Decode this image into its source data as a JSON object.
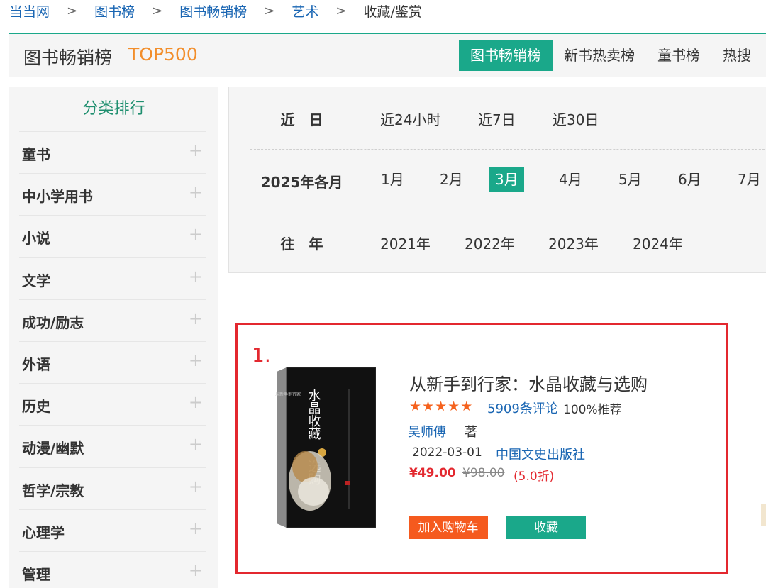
{
  "breadcrumb": [
    "当当网",
    "图书榜",
    "图书畅销榜",
    "艺术",
    "收藏/鉴赏"
  ],
  "header": {
    "title": "图书畅销榜",
    "subtitle": "TOP500",
    "tabs": [
      "图书畅销榜",
      "新书热卖榜",
      "童书榜",
      "热搜"
    ]
  },
  "sidebar": {
    "title": "分类排行",
    "items": [
      "童书",
      "中小学用书",
      "小说",
      "文学",
      "成功/励志",
      "外语",
      "历史",
      "动漫/幽默",
      "哲学/宗教",
      "心理学",
      "管理"
    ]
  },
  "filters": {
    "recent": {
      "label": "近　日",
      "options": [
        "近24小时",
        "近7日",
        "近30日"
      ]
    },
    "months": {
      "label": "2025年各月",
      "options": [
        "1月",
        "2月",
        "3月",
        "4月",
        "5月",
        "6月",
        "7月"
      ],
      "selected": "3月"
    },
    "years": {
      "label": "往　年",
      "options": [
        "2021年",
        "2022年",
        "2023年",
        "2024年"
      ]
    }
  },
  "book": {
    "rank": "1.",
    "title": "从新手到行家：水晶收藏与选购",
    "rating_stars": 5,
    "reviews": "5909条评论",
    "recommend": "100%推荐",
    "author": "吴师傅",
    "author_suffix": "著",
    "date": "2022-03-01",
    "publisher": "中国文史出版社",
    "price": "¥49.00",
    "original_price": "¥98.00",
    "discount": "(5.0折)",
    "cart_button": "加入购物车",
    "fav_button": "收藏",
    "cover_text": "水晶收藏与选购"
  },
  "colors": {
    "accent": "#1aa88a",
    "orange": "#f28e2b",
    "red": "#e3282f",
    "link": "#1a66b3"
  }
}
